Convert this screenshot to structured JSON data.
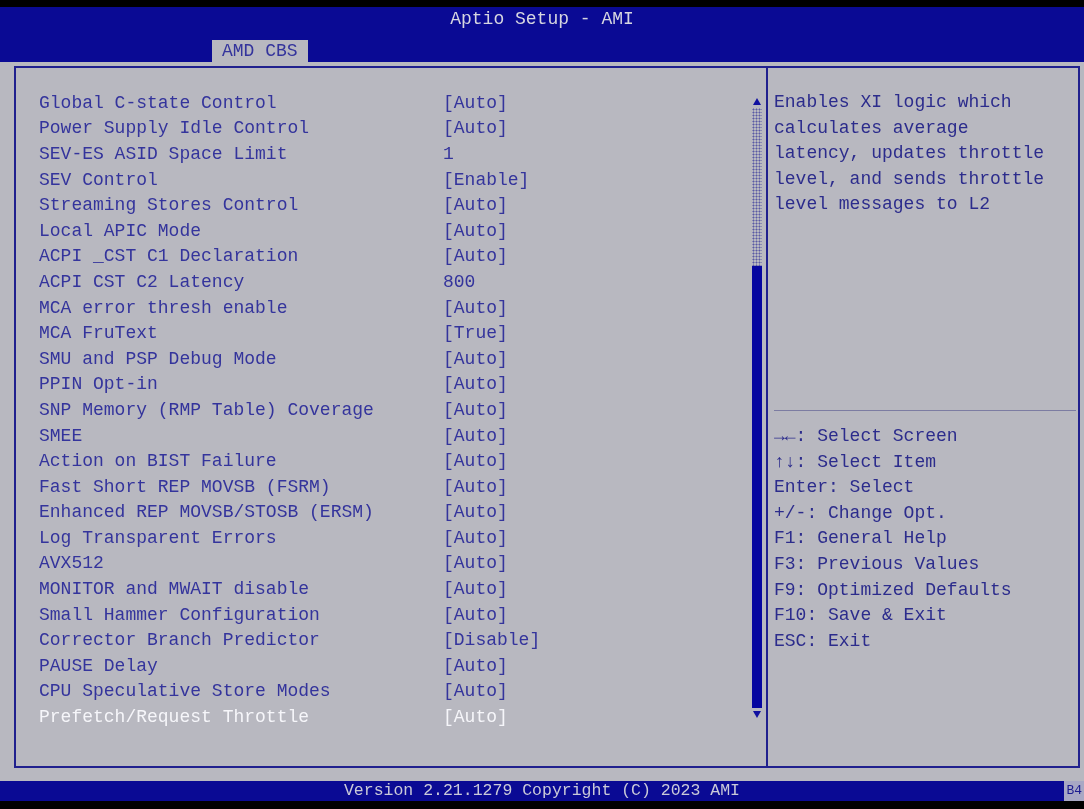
{
  "window": {
    "title": "Aptio Setup - AMI"
  },
  "tabs": [
    {
      "label": "AMD CBS",
      "selected": true
    }
  ],
  "settings": [
    {
      "label": "Global C-state Control",
      "value": "[Auto]",
      "selected": false
    },
    {
      "label": "Power Supply Idle Control",
      "value": "[Auto]",
      "selected": false
    },
    {
      "label": "SEV-ES ASID Space Limit",
      "value": "1",
      "selected": false
    },
    {
      "label": "SEV Control",
      "value": "[Enable]",
      "selected": false
    },
    {
      "label": "Streaming Stores Control",
      "value": "[Auto]",
      "selected": false
    },
    {
      "label": "Local APIC Mode",
      "value": "[Auto]",
      "selected": false
    },
    {
      "label": "ACPI _CST C1 Declaration",
      "value": "[Auto]",
      "selected": false
    },
    {
      "label": "ACPI CST C2 Latency",
      "value": "800",
      "selected": false
    },
    {
      "label": "MCA error thresh enable",
      "value": "[Auto]",
      "selected": false
    },
    {
      "label": "MCA FruText",
      "value": "[True]",
      "selected": false
    },
    {
      "label": "SMU and PSP Debug Mode",
      "value": "[Auto]",
      "selected": false
    },
    {
      "label": "PPIN Opt-in",
      "value": "[Auto]",
      "selected": false
    },
    {
      "label": "SNP Memory (RMP Table) Coverage",
      "value": "[Auto]",
      "selected": false
    },
    {
      "label": "SMEE",
      "value": "[Auto]",
      "selected": false
    },
    {
      "label": "Action on BIST Failure",
      "value": "[Auto]",
      "selected": false
    },
    {
      "label": "Fast Short REP MOVSB (FSRM)",
      "value": "[Auto]",
      "selected": false
    },
    {
      "label": "Enhanced REP MOVSB/STOSB (ERSM)",
      "value": "[Auto]",
      "selected": false
    },
    {
      "label": "Log Transparent Errors",
      "value": "[Auto]",
      "selected": false
    },
    {
      "label": "AVX512",
      "value": "[Auto]",
      "selected": false
    },
    {
      "label": "MONITOR and MWAIT disable",
      "value": "[Auto]",
      "selected": false
    },
    {
      "label": "Small Hammer Configuration",
      "value": "[Auto]",
      "selected": false
    },
    {
      "label": "Corrector Branch Predictor",
      "value": "[Disable]",
      "selected": false
    },
    {
      "label": "PAUSE Delay",
      "value": "[Auto]",
      "selected": false
    },
    {
      "label": "CPU Speculative Store Modes",
      "value": "[Auto]",
      "selected": false
    },
    {
      "label": "Prefetch/Request Throttle",
      "value": "[Auto]",
      "selected": true
    }
  ],
  "help": {
    "lines": [
      "Enables XI logic which",
      "calculates average",
      "latency, updates throttle",
      "level, and sends throttle",
      "level messages to L2"
    ]
  },
  "key_help": [
    "→←: Select Screen",
    "↑↓: Select Item",
    "Enter: Select",
    "+/-: Change Opt.",
    "F1: General Help",
    "F3: Previous Values",
    "F9: Optimized Defaults",
    "F10: Save & Exit",
    "ESC: Exit"
  ],
  "status_bar": {
    "version": "Version 2.21.1279 Copyright (C) 2023 AMI",
    "post_code": "B4"
  }
}
